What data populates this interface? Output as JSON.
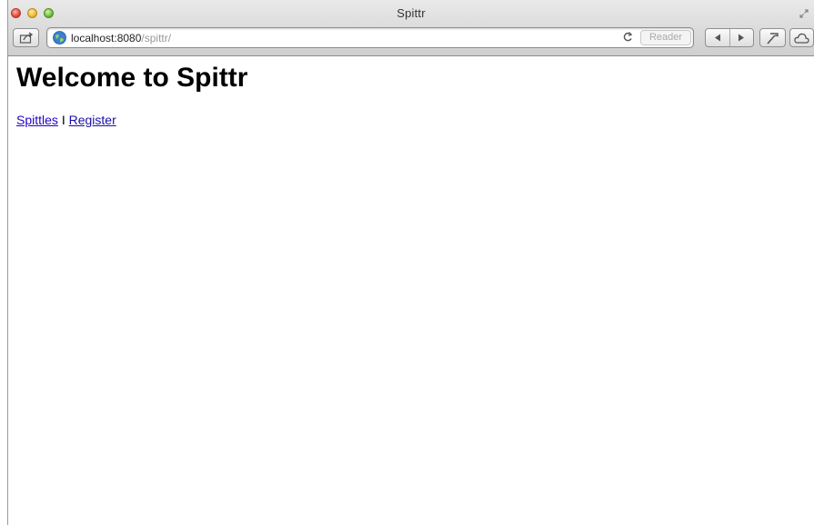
{
  "window": {
    "title": "Spittr"
  },
  "toolbar": {
    "url_host": "localhost:8080",
    "url_path": "/spittr/",
    "reader_label": "Reader",
    "reload_glyph": "C",
    "icons": [
      "share-icon",
      "globe-icon",
      "reload-icon",
      "back-icon",
      "forward-icon",
      "tools-icon",
      "cloud-icon",
      "fullscreen-icon"
    ]
  },
  "page": {
    "heading": "Welcome to Spittr",
    "links": [
      {
        "label": "Spittles"
      },
      {
        "label": "Register"
      }
    ],
    "separator": "I"
  },
  "colors": {
    "link": "#1a0dab",
    "chrome_top": "#e9e9e9",
    "chrome_bottom": "#cfcfcf"
  }
}
